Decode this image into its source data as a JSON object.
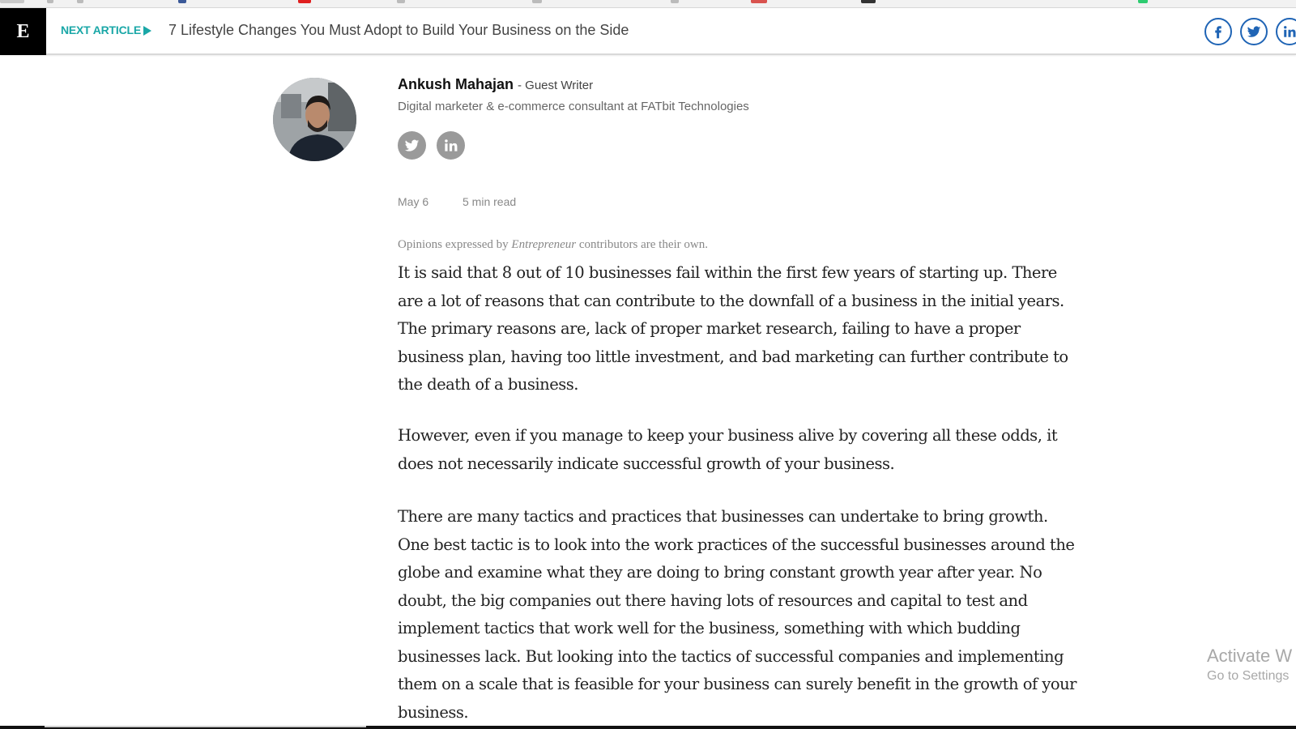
{
  "header": {
    "logo": "E",
    "next_label": "NEXT ARTICLE",
    "next_title": "7 Lifestyle Changes You Must Adopt to Build Your Business on the Side",
    "share_icons": [
      "facebook-icon",
      "twitter-icon",
      "linkedin-icon"
    ],
    "accent_color": "#1aa7a7",
    "share_color": "#1f64b5"
  },
  "author": {
    "name": "Ankush Mahajan",
    "role": "- Guest Writer",
    "bio": "Digital marketer & e-commerce consultant at FATbit Technologies",
    "social_icons": [
      "twitter-icon",
      "linkedin-icon"
    ]
  },
  "meta": {
    "date": "May 6",
    "read_time": "5 min read"
  },
  "article": {
    "disclaimer_prefix": "Opinions expressed by",
    "disclaimer_brand": "Entrepreneur",
    "disclaimer_suffix": "contributors are their own.",
    "paragraphs": [
      "It is said that 8 out of 10 businesses fail within the first few years of starting up. There are a lot of reasons that can contribute to the downfall of a business in the initial years. The primary reasons are, lack of proper market research, failing to have a proper business plan, having too little investment, and bad marketing can further contribute to the death of a business.",
      "However, even if you manage to keep your business alive by covering all these odds, it does not necessarily indicate successful growth of your business.",
      "There are many tactics and practices that businesses can undertake to bring growth. One best tactic is to look into the work practices of the successful businesses around the globe and examine what they are doing to bring constant growth year after year. No doubt, the big companies out there having lots of resources and capital to test and implement tactics that work well for the business, something with which budding businesses lack. But looking into the tactics of successful companies and implementing them on a scale that is feasible for your business can surely benefit in the growth of your business."
    ]
  },
  "watermark": {
    "line1": "Activate W",
    "line2": "Go to Settings"
  }
}
